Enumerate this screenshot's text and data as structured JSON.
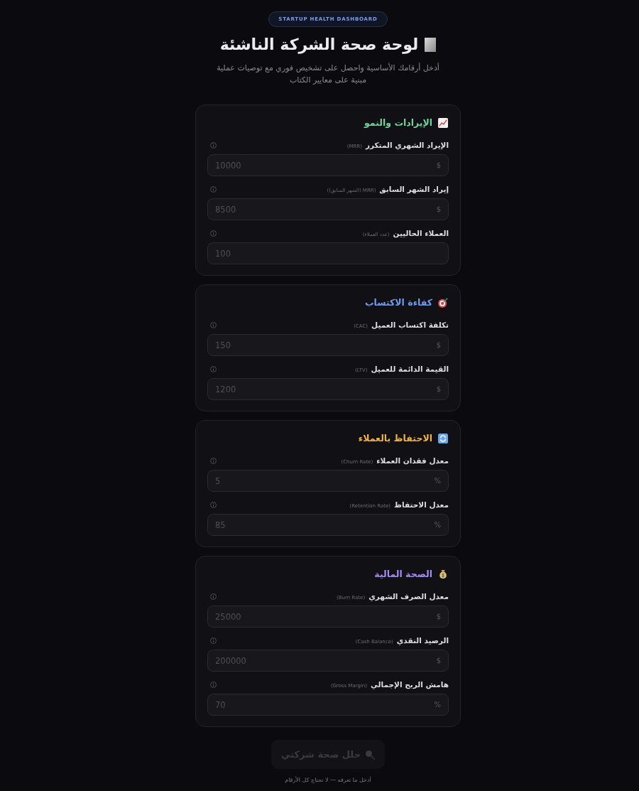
{
  "badge": "STARTUP HEALTH DASHBOARD",
  "title": "لوحة صحة الشركة الناشئة",
  "subtitle": "أدخل أرقامك الأساسية واحصل على تشخيص فوري مع توصيات عملية مبنية على معايير الكتاب",
  "sections": [
    {
      "title": "الإيرادات والنمو",
      "color": "#6fd49b",
      "fields": [
        {
          "label": "الإيراد الشهري المتكرر",
          "note": "(MRR)",
          "placeholder": "10000",
          "unit": "$"
        },
        {
          "label": "إيراد الشهر السابق",
          "note": "(MRR (الشهر السابق))",
          "placeholder": "8500",
          "unit": "$"
        },
        {
          "label": "العملاء الحاليين",
          "note": "(عدد العملاء)",
          "placeholder": "100"
        }
      ]
    },
    {
      "title": "كفاءة الاكتساب",
      "color": "#6f9cf2",
      "fields": [
        {
          "label": "تكلفة اكتساب العميل",
          "note": "(CAC)",
          "placeholder": "150",
          "unit": "$"
        },
        {
          "label": "القيمة الدائمة للعميل",
          "note": "(LTV)",
          "placeholder": "1200",
          "unit": "$"
        }
      ]
    },
    {
      "title": "الاحتفاظ بالعملاء",
      "color": "#f2b33d",
      "fields": [
        {
          "label": "معدل فقدان العملاء",
          "note": "(Churn Rate)",
          "placeholder": "5",
          "unit": "%"
        },
        {
          "label": "معدل الاحتفاظ",
          "note": "(Retention Rate)",
          "placeholder": "85",
          "unit": "%"
        }
      ]
    },
    {
      "title": "الصحة المالية",
      "color": "#a58af5",
      "fields": [
        {
          "label": "معدل الصرف الشهري",
          "note": "(Burn Rate)",
          "placeholder": "25000",
          "unit": "$"
        },
        {
          "label": "الرصيد النقدي",
          "note": "(Cash Balance)",
          "placeholder": "200000",
          "unit": "$"
        },
        {
          "label": "هامش الربح الإجمالي",
          "note": "(Gross Margin)",
          "placeholder": "70",
          "unit": "%"
        }
      ]
    }
  ],
  "button": {
    "label": "حلل صحة شركتي",
    "disabled": true
  },
  "footnote": "أدخل ما تعرفه — لا تحتاج كل الأرقام"
}
